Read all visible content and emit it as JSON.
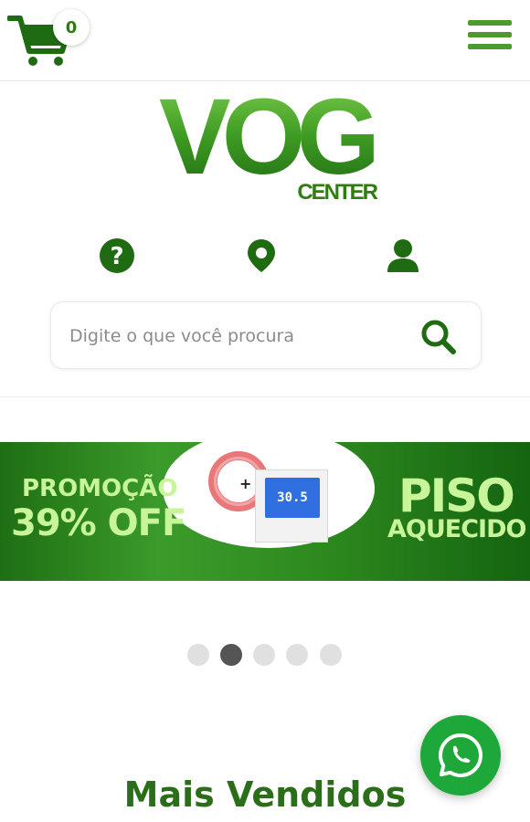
{
  "header": {
    "cart_count": "0"
  },
  "logo": {
    "main": "VOG",
    "sub": "CENTER"
  },
  "search": {
    "placeholder": "Digite o que você procura"
  },
  "banner": {
    "promo_label": "PROMOÇÃO",
    "promo_discount": "39% OFF",
    "product_line1": "PISO",
    "product_line2": "AQUECIDO",
    "thermostat_display": "30.5"
  },
  "carousel": {
    "total_slides": 5,
    "active_slide": 2
  },
  "section": {
    "title": "Mais Vendidos"
  },
  "colors": {
    "brand_green": "#2f7d0f",
    "menu_green": "#4f9a2f",
    "icon_green": "#1f6b12",
    "whatsapp_green": "#1fa83a"
  }
}
